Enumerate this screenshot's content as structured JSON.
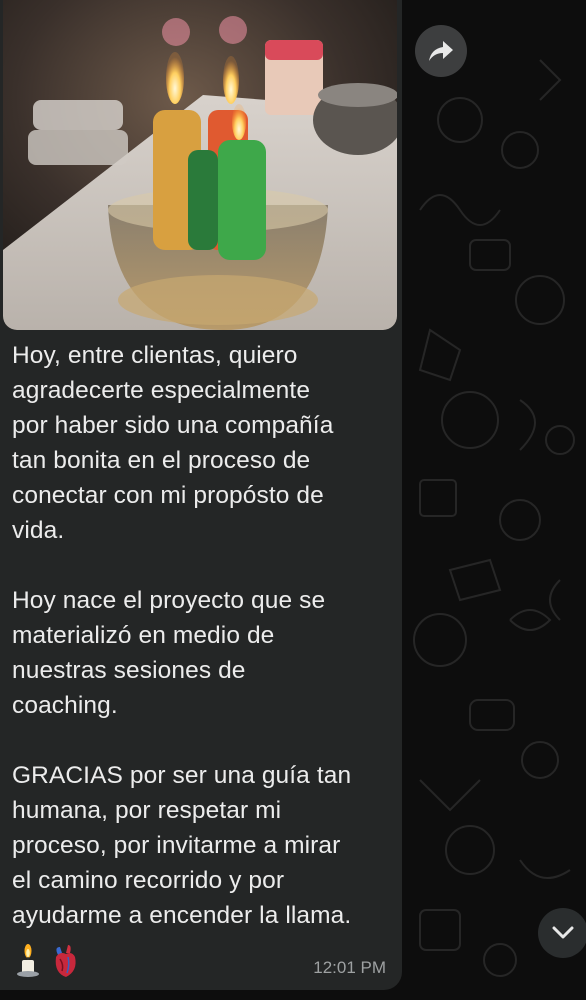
{
  "message": {
    "paragraphs": [
      "Hoy, entre clientas, quiero\nagradecerte especialmente\npor haber sido una compañía\ntan bonita en el proceso de\nconectar con mi propósto de\nvida.",
      "Hoy nace el proyecto que se\nmaterializó en medio de\nnuestras sesiones de\ncoaching.",
      "GRACIAS por ser una guía tan\nhumana, por respetar mi\nproceso, por invitarme a mirar\nel camino recorrido y por\nayudarme a encender la llama."
    ],
    "emojis": [
      "candle-emoji",
      "anatomical-heart-emoji"
    ],
    "timestamp": "12:01 PM"
  },
  "controls": {
    "forward_icon": "forward-arrow-icon",
    "scroll_icon": "chevron-down-icon"
  },
  "colors": {
    "bubble": "#242626",
    "text": "#ececec",
    "timestamp": "#9ea1a2",
    "background": "#0d0d0d"
  }
}
